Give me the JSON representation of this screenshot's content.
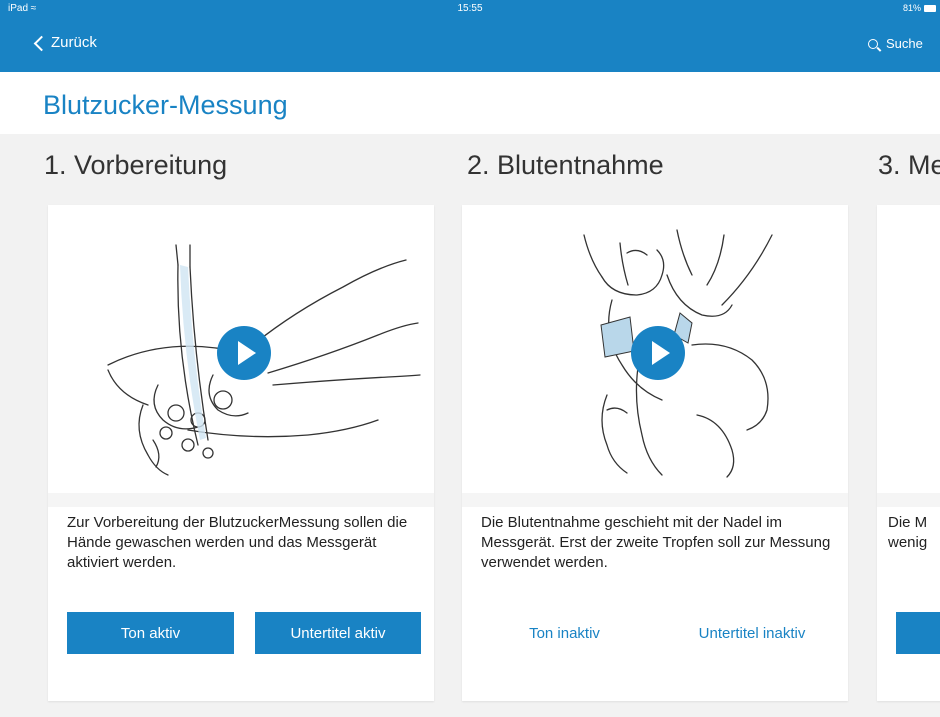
{
  "status_bar": {
    "device": "iPad",
    "time": "15:55",
    "battery": "81%"
  },
  "nav": {
    "back_label": "Zurück",
    "search_label": "Suche"
  },
  "page_title": "Blutzucker-Messung",
  "sections": [
    {
      "title": "1. Vorbereitung",
      "description": "Zur Vorbereitung der BlutzuckerMessung sollen die Hände gewaschen werden und das Messgerät aktiviert werden.",
      "sound_button": "Ton aktiv",
      "subtitle_button": "Untertitel aktiv",
      "sound_active": true,
      "subtitle_active": true
    },
    {
      "title": "2. Blutentnahme",
      "description": "Die Blutentnahme geschieht mit der Nadel im Messgerät. Erst der zweite Tropfen soll zur Messung verwendet werden.",
      "sound_button": "Ton inaktiv",
      "subtitle_button": "Untertitel inaktiv",
      "sound_active": false,
      "subtitle_active": false
    },
    {
      "title": "3. Me",
      "description_line1": "Die M",
      "description_line2": "wenig"
    }
  ],
  "colors": {
    "accent": "#1983c4",
    "background": "#f2f2f2",
    "text": "#222222"
  },
  "icons": {
    "back": "chevron-left-icon",
    "search": "search-icon",
    "play": "play-icon",
    "wifi": "wifi-icon",
    "battery": "battery-icon"
  }
}
